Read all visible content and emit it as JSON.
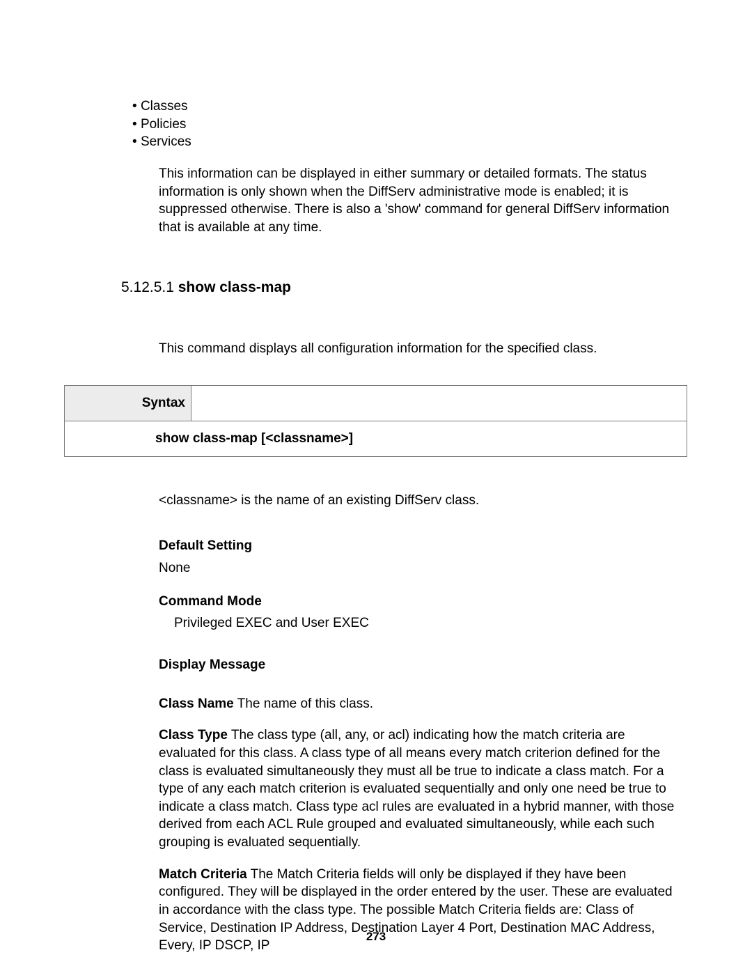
{
  "bullets": {
    "b0": "Classes",
    "b1": "Policies",
    "b2": "Services"
  },
  "intro_para": "This information can be displayed in either summary or detailed formats. The status information is only shown when the DiffServ administrative mode is enabled; it is suppressed otherwise. There is also a 'show' command for general DiffServ information that is available at any time.",
  "heading": {
    "number": "5.12.5.1",
    "title": "show class-map"
  },
  "desc": "This command displays all configuration information for the specified class.",
  "syntax": {
    "label": "Syntax",
    "command": "show class-map [<classname>]"
  },
  "classname_para": "<classname> is the name of an existing DiffServ class.",
  "default_setting": {
    "label": "Default Setting",
    "value": "None"
  },
  "command_mode": {
    "label": "Command Mode",
    "value": "Privileged EXEC and User EXEC"
  },
  "display_message": {
    "label": "Display Message"
  },
  "fields": {
    "class_name": {
      "name": "Class Name",
      "text": " The name of this class."
    },
    "class_type": {
      "name": "Class Type",
      "text": " The class type (all, any, or acl) indicating how the match criteria are evaluated for this class. A class type of all means every match criterion defined for the class is evaluated simultaneously they must all be true to indicate a class match. For a type of any each match criterion is evaluated sequentially and only one need be true to indicate a class match. Class type acl rules are evaluated in a hybrid manner, with those derived from each ACL Rule grouped and evaluated simultaneously, while each such grouping is evaluated sequentially."
    },
    "match_criteria": {
      "name": "Match Criteria",
      "text": " The Match Criteria fields will only be displayed if they have been configured. They will be displayed in the order entered by the user. These are evaluated in accordance with the class type. The possible Match Criteria fields are: Class of Service, Destination IP Address, Destination Layer 4 Port, Destination MAC Address, Every, IP DSCP, IP"
    }
  },
  "page_number": "273"
}
